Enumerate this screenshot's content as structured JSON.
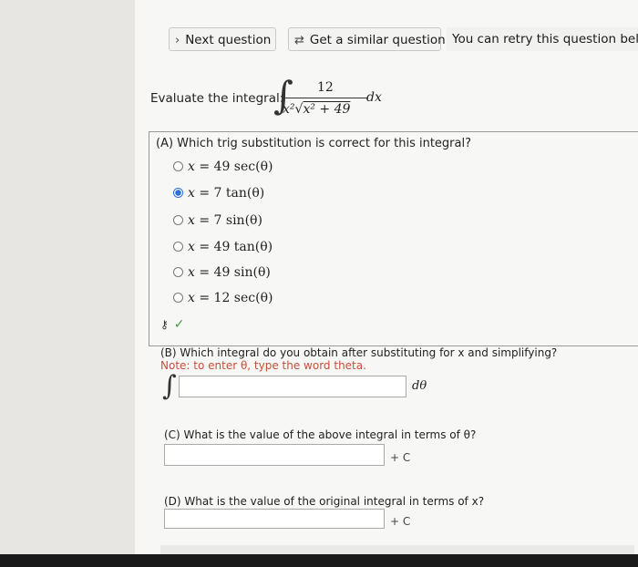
{
  "toolbar": {
    "next_label": "Next question",
    "similar_label": "Get a similar question",
    "retry_note": "You can retry this question below"
  },
  "question": {
    "prompt": "Evaluate the integral:",
    "numerator": "12",
    "denominator_prefix": "x²",
    "radicand": "x² + 49",
    "differential": "dx"
  },
  "partA": {
    "title": "(A) Which trig substitution is correct for this integral?",
    "options": [
      {
        "lhs": "x",
        "rhs": "= 49 sec(θ)",
        "selected": false
      },
      {
        "lhs": "x",
        "rhs": "= 7 tan(θ)",
        "selected": true
      },
      {
        "lhs": "x",
        "rhs": "= 7 sin(θ)",
        "selected": false
      },
      {
        "lhs": "x",
        "rhs": "= 49 tan(θ)",
        "selected": false
      },
      {
        "lhs": "x",
        "rhs": "= 49 sin(θ)",
        "selected": false
      },
      {
        "lhs": "x",
        "rhs": "= 12 sec(θ)",
        "selected": false
      }
    ],
    "status": "correct"
  },
  "partB": {
    "title": "(B) Which integral do you obtain after substituting for x and simplifying?",
    "note": "Note: to enter θ, type the word theta.",
    "input_value": "",
    "differential": "dθ"
  },
  "partC": {
    "title": "(C) What is the value of the above integral in terms of θ?",
    "input_value": "",
    "suffix": "+ C"
  },
  "partD": {
    "title": "(D) What is the value of the original integral in terms of x?",
    "input_value": "",
    "suffix": "+ C"
  },
  "colors": {
    "accent": "#2d6fd6",
    "correct": "#3c9a3c",
    "note": "#c5503a"
  }
}
